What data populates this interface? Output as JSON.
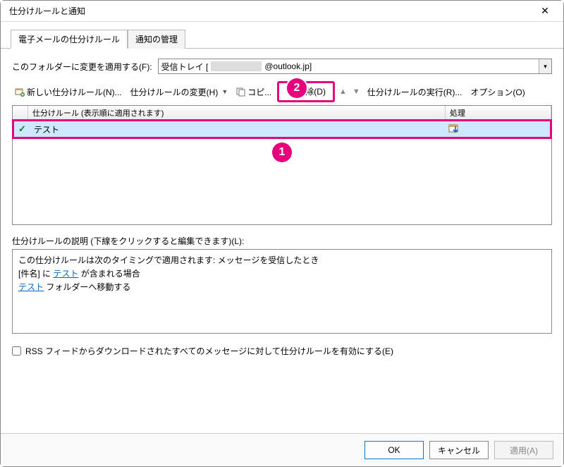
{
  "window": {
    "title": "仕分けルールと通知"
  },
  "tabs": {
    "email_rules": "電子メールの仕分けルール",
    "manage_alerts": "通知の管理"
  },
  "folder": {
    "label": "このフォルダーに変更を適用する(F):",
    "prefix": "受信トレイ [",
    "suffix": "@outlook.jp]"
  },
  "toolbar": {
    "new_rule": "新しい仕分けルール(N)...",
    "change_rule": "仕分けルールの変更(H)",
    "copy": "コピ...",
    "delete": "削除(D)",
    "run_rules": "仕分けルールの実行(R)...",
    "options": "オプション(O)"
  },
  "rules_header": {
    "name": "仕分けルール (表示順に適用されます)",
    "action": "処理"
  },
  "rules": [
    {
      "checked": true,
      "name": "テスト"
    }
  ],
  "description": {
    "label": "仕分けルールの説明 (下線をクリックすると編集できます)(L):",
    "line1_a": "この仕分けルールは次のタイミングで適用されます: メッセージを受信したとき",
    "line2_a": "[件名] に ",
    "line2_link": "テスト",
    "line2_b": " が含まれる場合",
    "line3_link": "テスト",
    "line3_b": " フォルダーへ移動する"
  },
  "rss": {
    "label": "RSS フィードからダウンロードされたすべてのメッセージに対して仕分けルールを有効にする(E)"
  },
  "buttons": {
    "ok": "OK",
    "cancel": "キャンセル",
    "apply": "適用(A)"
  },
  "callouts": {
    "one": "1",
    "two": "2"
  }
}
